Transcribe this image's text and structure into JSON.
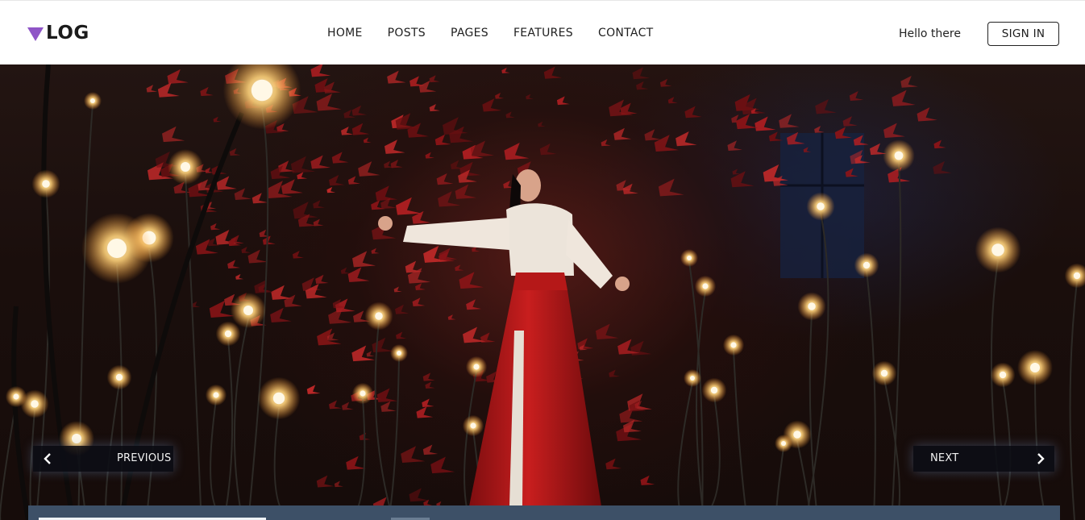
{
  "header": {
    "logo_text": "LOG",
    "logo_mark_color": "#8f55c7",
    "nav": [
      {
        "label": "HOME"
      },
      {
        "label": "POSTS"
      },
      {
        "label": "PAGES"
      },
      {
        "label": "FEATURES"
      },
      {
        "label": "CONTACT"
      }
    ],
    "greeting": "Hello there",
    "sign_in_label": "SIGN IN"
  },
  "hero": {
    "previous_label": "PREVIOUS",
    "next_label": "NEXT",
    "progress_fraction": 0.225,
    "progress_color": "#eef2f6",
    "bar_color": "#3d5067"
  }
}
